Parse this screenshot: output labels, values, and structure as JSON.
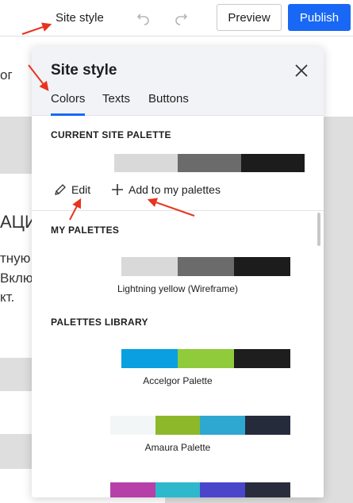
{
  "topbar": {
    "site_style": "Site style",
    "preview": "Preview",
    "publish": "Publish",
    "undo_icon": "undo-icon",
    "redo_icon": "redo-icon"
  },
  "background_page": {
    "frag_1": "ог",
    "frag_2": "АЦИ",
    "frag_3": "тную",
    "frag_4": "Вклю",
    "frag_5": "кт."
  },
  "panel": {
    "title": "Site style",
    "tabs": [
      "Colors",
      "Texts",
      "Buttons"
    ],
    "active_tab": "Colors",
    "current_palette": {
      "heading": "CURRENT SITE PALETTE",
      "colors": [
        "#ffffff",
        "#d9d9d9",
        "#6b6b6b",
        "#1c1c1c"
      ]
    },
    "edit_label": "Edit",
    "add_label": "Add to my palettes",
    "my_palettes": {
      "heading": "MY PALETTES",
      "items": [
        {
          "name": "Lightning yellow (Wireframe)",
          "colors": [
            "#ffffff",
            "#d9d9d9",
            "#6b6b6b",
            "#1c1c1c"
          ]
        }
      ]
    },
    "library": {
      "heading": "PALETTES LIBRARY",
      "items": [
        {
          "name": "Accelgor Palette",
          "colors": [
            "#ffffff",
            "#0a9fe0",
            "#8fcb3a",
            "#1e1e1e"
          ]
        },
        {
          "name": "Amaura Palette",
          "colors": [
            "#ffffff",
            "#f3f6f7",
            "#8cb82a",
            "#2ea8d0",
            "#262b3c"
          ]
        },
        {
          "name": "",
          "colors": [
            "#ffffff",
            "#b640a8",
            "#2eb8cc",
            "#4a46cc",
            "#282c3c"
          ]
        }
      ]
    }
  },
  "colors": {
    "accent": "#1968f5",
    "annotation_arrow": "#e8341f"
  }
}
